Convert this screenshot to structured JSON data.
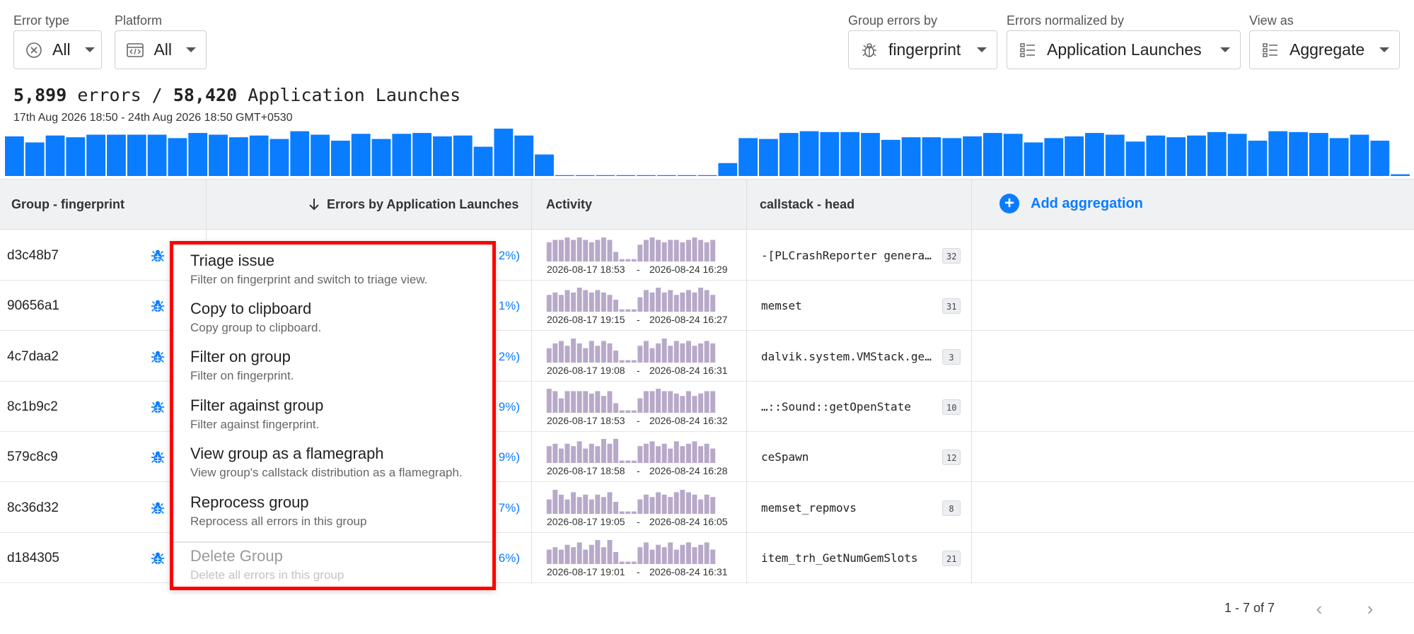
{
  "filters": {
    "error_type": {
      "label": "Error type",
      "value": "All"
    },
    "platform": {
      "label": "Platform",
      "value": "All"
    },
    "group_by": {
      "label": "Group errors by",
      "value": "fingerprint"
    },
    "normalized_by": {
      "label": "Errors normalized by",
      "value": "Application Launches"
    },
    "view_as": {
      "label": "View as",
      "value": "Aggregate"
    }
  },
  "summary": {
    "errors": "5,899",
    "errors_word": "errors /",
    "launches": "58,420",
    "launches_word": "Application Launches",
    "date_range": "17th Aug 2026 18:50 - 24th Aug 2026 18:50 GMT+0530"
  },
  "histogram": {
    "values": [
      46,
      39,
      47,
      45,
      48,
      48,
      48,
      48,
      44,
      50,
      48,
      45,
      47,
      43,
      52,
      48,
      41,
      49,
      43,
      49,
      50,
      46,
      47,
      34,
      55,
      47,
      25,
      1,
      1,
      1,
      1,
      1,
      1,
      1,
      1,
      15,
      44,
      43,
      50,
      52,
      51,
      51,
      50,
      42,
      45,
      45,
      44,
      46,
      50,
      49,
      39,
      44,
      46,
      50,
      48,
      40,
      47,
      45,
      47,
      51,
      49,
      41,
      52,
      51,
      50,
      44,
      48,
      41,
      2
    ],
    "max": 55
  },
  "table": {
    "headers": {
      "group": "Group - fingerprint",
      "errors": "Errors by Application Launches",
      "activity": "Activity",
      "callstack": "callstack - head",
      "add_aggregation": "Add aggregation"
    },
    "rows": [
      {
        "id": "d3c48b7",
        "pct": "2%)",
        "start": "2026-08-17 18:53",
        "end": "2026-08-24 16:29",
        "callstack": "-[PLCrashReporter genera…",
        "count": "32",
        "spark": [
          8,
          9,
          9,
          10,
          9,
          10,
          9,
          8,
          9,
          10,
          9,
          4,
          1,
          1,
          1,
          7,
          9,
          10,
          9,
          8,
          9,
          9,
          8,
          9,
          10,
          9,
          8,
          9
        ]
      },
      {
        "id": "90656a1",
        "pct": "1%)",
        "start": "2026-08-17 19:15",
        "end": "2026-08-24 16:27",
        "callstack": "memset",
        "count": "31",
        "spark": [
          7,
          8,
          7,
          9,
          8,
          10,
          9,
          8,
          9,
          8,
          7,
          5,
          1,
          1,
          1,
          6,
          9,
          8,
          10,
          8,
          9,
          7,
          8,
          9,
          8,
          10,
          9,
          7
        ]
      },
      {
        "id": "4c7daa2",
        "pct": "2%)",
        "start": "2026-08-17 19:08",
        "end": "2026-08-24 16:31",
        "callstack": "dalvik.system.VMStack.ge…",
        "count": "3",
        "spark": [
          6,
          8,
          9,
          7,
          10,
          8,
          6,
          9,
          7,
          9,
          8,
          5,
          1,
          1,
          1,
          7,
          9,
          6,
          8,
          10,
          7,
          9,
          8,
          9,
          7,
          8,
          9,
          8
        ]
      },
      {
        "id": "8c1b9c2",
        "pct": "9%)",
        "start": "2026-08-17 18:53",
        "end": "2026-08-24 16:32",
        "callstack": "…::Sound::getOpenState",
        "count": "10",
        "spark": [
          10,
          9,
          6,
          9,
          9,
          9,
          9,
          8,
          9,
          7,
          9,
          4,
          1,
          1,
          1,
          6,
          9,
          9,
          10,
          9,
          9,
          8,
          7,
          9,
          7,
          8,
          9,
          9
        ]
      },
      {
        "id": "579c8c9",
        "pct": "9%)",
        "start": "2026-08-17 18:58",
        "end": "2026-08-24 16:28",
        "callstack": "ceSpawn",
        "count": "12",
        "spark": [
          7,
          8,
          6,
          8,
          7,
          9,
          6,
          8,
          7,
          10,
          8,
          10,
          1,
          1,
          1,
          7,
          8,
          9,
          7,
          8,
          6,
          9,
          7,
          8,
          9,
          7,
          8,
          6
        ]
      },
      {
        "id": "8c36d32",
        "pct": "7%)",
        "start": "2026-08-17 19:05",
        "end": "2026-08-24 16:05",
        "callstack": "memset_repmovs",
        "count": "8",
        "spark": [
          6,
          10,
          8,
          6,
          9,
          7,
          8,
          6,
          8,
          7,
          9,
          5,
          1,
          1,
          1,
          6,
          8,
          7,
          9,
          8,
          7,
          9,
          10,
          9,
          8,
          6,
          8,
          7
        ]
      },
      {
        "id": "d184305",
        "pct": "6%)",
        "start": "2026-08-17 19:01",
        "end": "2026-08-24 16:31",
        "callstack": "item_trh_GetNumGemSlots",
        "count": "21",
        "spark": [
          6,
          7,
          6,
          8,
          7,
          9,
          6,
          8,
          10,
          7,
          10,
          5,
          1,
          1,
          1,
          7,
          9,
          6,
          8,
          7,
          9,
          6,
          8,
          9,
          7,
          8,
          9,
          6
        ]
      }
    ]
  },
  "context_menu": {
    "items": [
      {
        "title": "Triage issue",
        "desc": "Filter on fingerprint and switch to triage view."
      },
      {
        "title": "Copy to clipboard",
        "desc": "Copy group to clipboard."
      },
      {
        "title": "Filter on group",
        "desc": "Filter on fingerprint."
      },
      {
        "title": "Filter against group",
        "desc": "Filter against fingerprint."
      },
      {
        "title": "View group as a flamegraph",
        "desc": "View group's callstack distribution as a flamegraph."
      },
      {
        "title": "Reprocess group",
        "desc": "Reprocess all errors in this group"
      },
      {
        "title": "Delete Group",
        "desc": "Delete all errors in this group"
      }
    ]
  },
  "pagination": {
    "text": "1 - 7 of 7"
  },
  "colors": {
    "accent": "#0a7cff",
    "spark": "#b8a9c9",
    "highlight": "#ff0000"
  }
}
